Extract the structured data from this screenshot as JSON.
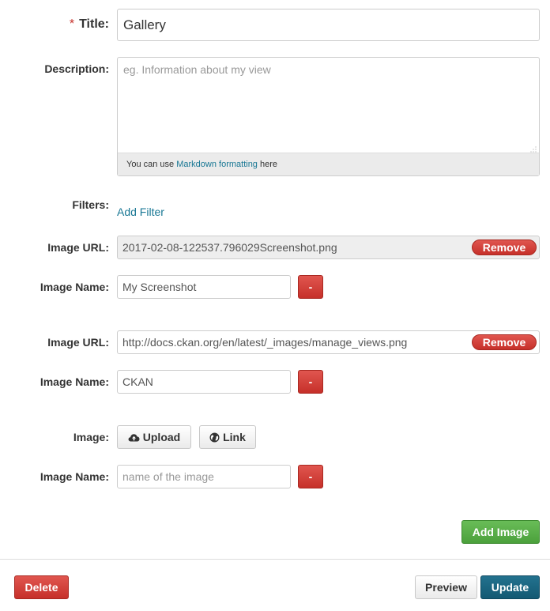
{
  "form": {
    "title": {
      "label": "Title:",
      "required_marker": "*",
      "value": "Gallery"
    },
    "description": {
      "label": "Description:",
      "placeholder": "eg. Information about my view",
      "help_prefix": "You can use",
      "help_link": "Markdown formatting",
      "help_suffix": "here"
    },
    "filters": {
      "label": "Filters:",
      "add_link": "Add Filter"
    },
    "images": [
      {
        "url_label": "Image URL:",
        "url_value": "2017-02-08-122537.796029Screenshot.png",
        "url_readonly": true,
        "remove_label": "Remove",
        "name_label": "Image Name:",
        "name_value": "My Screenshot",
        "minus_label": "-"
      },
      {
        "url_label": "Image URL:",
        "url_value": "http://docs.ckan.org/en/latest/_images/manage_views.png",
        "url_readonly": false,
        "remove_label": "Remove",
        "name_label": "Image Name:",
        "name_value": "CKAN",
        "minus_label": "-"
      }
    ],
    "new_image": {
      "label": "Image:",
      "upload_label": "Upload",
      "upload_icon": "cloud-upload-icon",
      "link_label": "Link",
      "link_icon": "globe-icon",
      "name_label": "Image Name:",
      "name_placeholder": "name of the image",
      "minus_label": "-"
    },
    "add_image_label": "Add Image"
  },
  "actions": {
    "delete_label": "Delete",
    "preview_label": "Preview",
    "update_label": "Update"
  },
  "colors": {
    "danger": "#c6302a",
    "success": "#4ba13c",
    "primary": "#135973",
    "link": "#187794"
  }
}
